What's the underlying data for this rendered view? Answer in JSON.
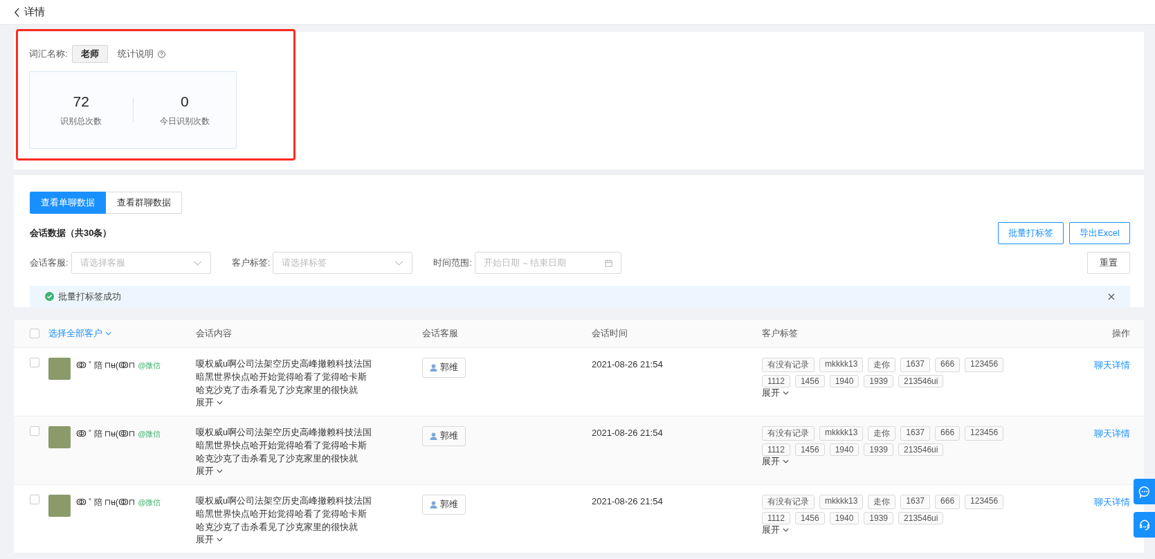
{
  "header": {
    "title": "详情"
  },
  "summary": {
    "word_label": "词汇名称:",
    "word": "老师",
    "help_label": "统计说明",
    "highlighted": true,
    "stats": [
      {
        "value": "72",
        "label": "识别总次数"
      },
      {
        "value": "0",
        "label": "今日识别次数"
      }
    ]
  },
  "tabs": [
    {
      "label": "查看单聊数据",
      "selected": true
    },
    {
      "label": "查看群聊数据",
      "selected": false
    }
  ],
  "section_title": "会话数据（共30条）",
  "actions": [
    "批量打标签",
    "导出Excel"
  ],
  "filters": [
    {
      "kind": "select",
      "label": "会话客服:",
      "placeholder": "请选择客服"
    },
    {
      "kind": "select",
      "label": "客户标签:",
      "placeholder": "请选择标签"
    },
    {
      "kind": "date_range",
      "label": "时间范围:",
      "start_placeholder": "开始日期",
      "separator": "~",
      "end_placeholder": "结束日期"
    }
  ],
  "reset": "重置",
  "alert": {
    "text": "批量打标签成功"
  },
  "table": {
    "all_checked": false,
    "select_all": "选择全部客户",
    "columns": [
      "会话内容",
      "会话客服",
      "会话时间",
      "客户标签",
      "操作"
    ],
    "rows": [
      {
        "checked": false,
        "name": "ↂ ˚ 陪 ⊓ʉ(ↂ⊓",
        "source": "@微信",
        "content": "嗄权威u啊公司法架空历史高峰撤赖科技法国暗黑世界快点哈开始觉得哈看了觉得哈卡斯哈克沙克了击杀看见了沙克家里的很快就",
        "content_expand": "展开",
        "agent": "郭维",
        "time": "2021-08-26 21:54",
        "tags": [
          "有没有记录",
          "mkkkk13",
          "走你",
          "1637",
          "666",
          "123456",
          "1112",
          "1456",
          "1940",
          "1939",
          "213546ui"
        ],
        "tags_expand": "展开",
        "action": "聊天详情"
      },
      {
        "checked": false,
        "name": "ↂ ˚ 陪 ⊓ʉ(ↂ⊓",
        "source": "@微信",
        "content": "嗄权威u啊公司法架空历史高峰撤赖科技法国暗黑世界快点哈开始觉得哈看了觉得哈卡斯哈克沙克了击杀看见了沙克家里的很快就",
        "content_expand": "展开",
        "agent": "郭维",
        "time": "2021-08-26 21:54",
        "tags": [
          "有没有记录",
          "mkkkk13",
          "走你",
          "1637",
          "666",
          "123456",
          "1112",
          "1456",
          "1940",
          "1939",
          "213546ui"
        ],
        "tags_expand": "展开",
        "action": "聊天详情"
      },
      {
        "checked": false,
        "name": "ↂ ˚ 陪 ⊓ʉ(ↂ⊓",
        "source": "@微信",
        "content": "嗄权威u啊公司法架空历史高峰撤赖科技法国暗黑世界快点哈开始觉得哈看了觉得哈卡斯哈克沙克了击杀看见了沙克家里的很快就",
        "content_expand": "展开",
        "agent": "郭维",
        "time": "2021-08-26 21:54",
        "tags": [
          "有没有记录",
          "mkkkk13",
          "走你",
          "1637",
          "666",
          "123456",
          "1112",
          "1456",
          "1940",
          "1939",
          "213546ui"
        ],
        "tags_expand": "展开",
        "action": "聊天详情"
      }
    ]
  }
}
